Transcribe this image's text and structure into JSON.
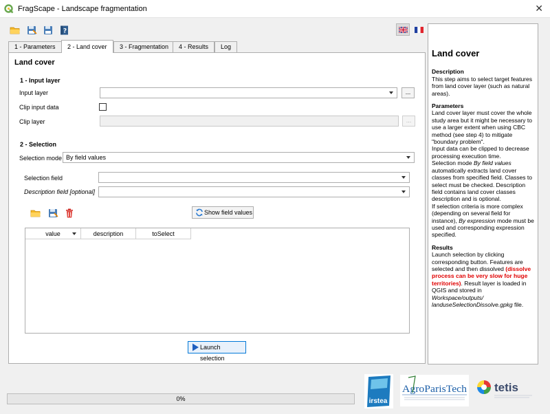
{
  "window": {
    "title": "FragScape - Landscape fragmentation",
    "close": "✕"
  },
  "tabs": [
    {
      "label": "1 - Parameters"
    },
    {
      "label": "2 - Land cover"
    },
    {
      "label": "3 - Fragmentation"
    },
    {
      "label": "4 - Results"
    },
    {
      "label": "Log"
    }
  ],
  "panel": {
    "title": "Land cover",
    "input_section": {
      "heading": "1 - Input layer",
      "input_layer_label": "Input layer",
      "input_layer_value": "",
      "browse": "...",
      "clip_label": "Clip input data",
      "clip_checked": false,
      "clip_layer_label": "Clip layer",
      "clip_layer_value": ""
    },
    "selection_section": {
      "heading": "2 - Selection",
      "mode_label": "Selection mode",
      "mode_value": "By field values",
      "field_label": "Selection field",
      "field_value": "",
      "description_label": "Description field [optional]",
      "description_value": "",
      "show_values_button": "Show field values",
      "columns": [
        "value",
        "description",
        "toSelect"
      ],
      "rows": []
    },
    "launch_button": "Launch selection"
  },
  "help": {
    "title": "Land cover",
    "description_heading": "Description",
    "description_text": " This step aims to select target features from land cover layer (such as natural areas).",
    "parameters_heading": "Parameters",
    "param_p1": " Land cover layer must cover the whole study area but it might be necessary to use a larger extent when using CBC method (see step 4) to mitigate \"boundary problem\".",
    "param_p2": " Input data can be clipped to decrease processing execution time.",
    "param_p3_a": " Selection mode ",
    "param_p3_em": "By field values",
    "param_p3_b": " automatically extracts land cover classes from specified field. Classes to select must be checked. Description field contains land cover classes description and is optional.",
    "param_p4_a": " If selection criteria is more complex (depending on several field for instance), ",
    "param_p4_em": "By expression",
    "param_p4_b": " mode must be used and corresponding expression specified.",
    "results_heading": "Results",
    "results_a": " Launch selection by clicking corresponding button. Features are selected and then dissolved ",
    "results_red": "(dissolve process can be very slow for huge territories)",
    "results_b": ". Result layer is loaded in QGIS and stored in ",
    "results_em": "Workspace/outputs/ landuseSelectionDissolve.gpkg",
    "results_c": " file."
  },
  "progress": {
    "value": 0,
    "label": "0%"
  },
  "logos": {
    "irstea": "irstea",
    "agro": "AgroParisTech",
    "tetis": "tetis"
  },
  "colors": {
    "accent": "#0078d7",
    "warning": "#e00000",
    "qgis_green": "#6aa84f",
    "irstea_blue": "#1d7bbf",
    "tetis_dark": "#3b4a6b"
  }
}
